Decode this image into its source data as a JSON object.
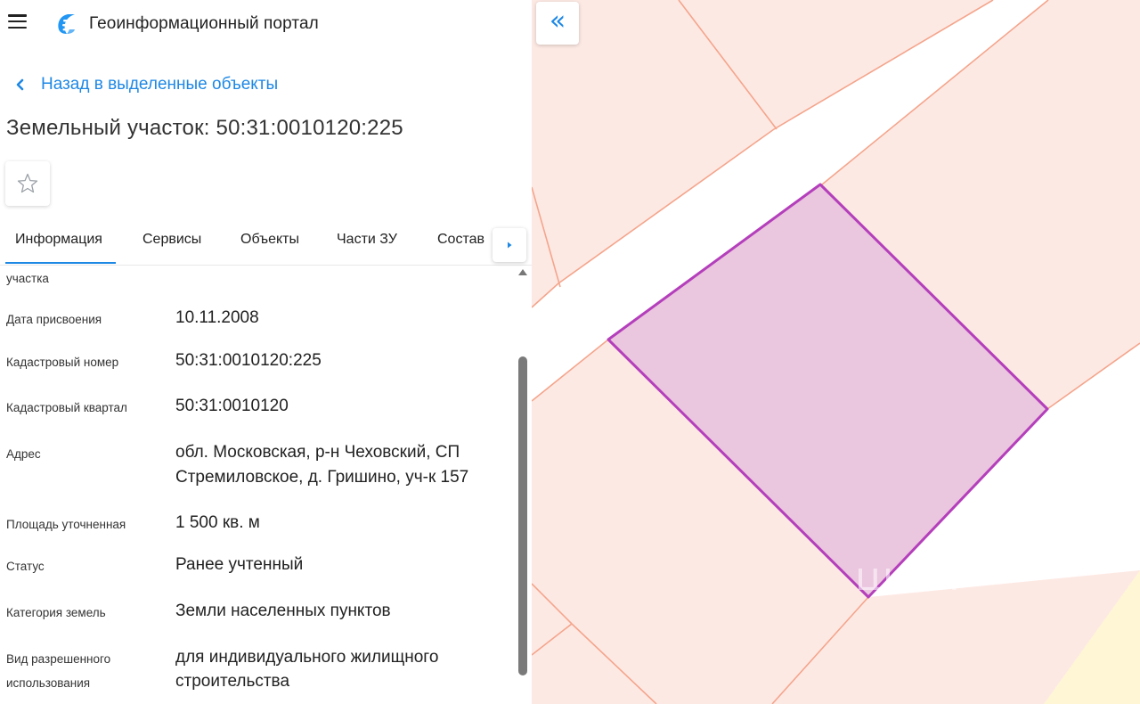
{
  "header": {
    "app_title": "Геоинформационный портал",
    "menu_icon": "hamburger-menu-icon",
    "logo_icon": "portal-logo-icon"
  },
  "navigation": {
    "back_label": "Назад в выделенные объекты"
  },
  "object": {
    "title": "Земельный участок: 50:31:0010120:225"
  },
  "tabs": [
    {
      "label": "Информация",
      "active": true
    },
    {
      "label": "Сервисы",
      "active": false
    },
    {
      "label": "Объекты",
      "active": false
    },
    {
      "label": "Части ЗУ",
      "active": false
    },
    {
      "label": "Состав",
      "active": false
    }
  ],
  "info": {
    "partial_label": "участка",
    "rows": [
      {
        "label": "Дата присвоения",
        "value": "10.11.2008"
      },
      {
        "label": "Кадастровый номер",
        "value": "50:31:0010120:225"
      },
      {
        "label": "Кадастровый квартал",
        "value": "50:31:0010120"
      },
      {
        "label": "Адрес",
        "value_lines": [
          "обл. Московская, р-н Чеховский, СП",
          "Стремиловское, д. Гришино, уч-к 157"
        ]
      },
      {
        "label": "Площадь уточненная",
        "value": "1 500 кв. м"
      },
      {
        "label": "Статус",
        "value": "Ранее учтенный"
      },
      {
        "label": "Категория земель",
        "value": "Земли населенных пунктов"
      },
      {
        "label_lines": [
          "Вид разрешенного",
          "использования"
        ],
        "value_lines": [
          "для индивидуального жилищного",
          "строительства"
        ]
      }
    ]
  },
  "map": {
    "collapse_icon": "double-chevron-left-icon",
    "watermark": "циан",
    "colors": {
      "parcel_fill": "#fde9e4",
      "parcel_border": "#f4a58c",
      "road": "#ffffff",
      "selected_fill": "#ebc6df",
      "selected_border": "#b43fbb",
      "accent": "#1e88e5"
    }
  }
}
